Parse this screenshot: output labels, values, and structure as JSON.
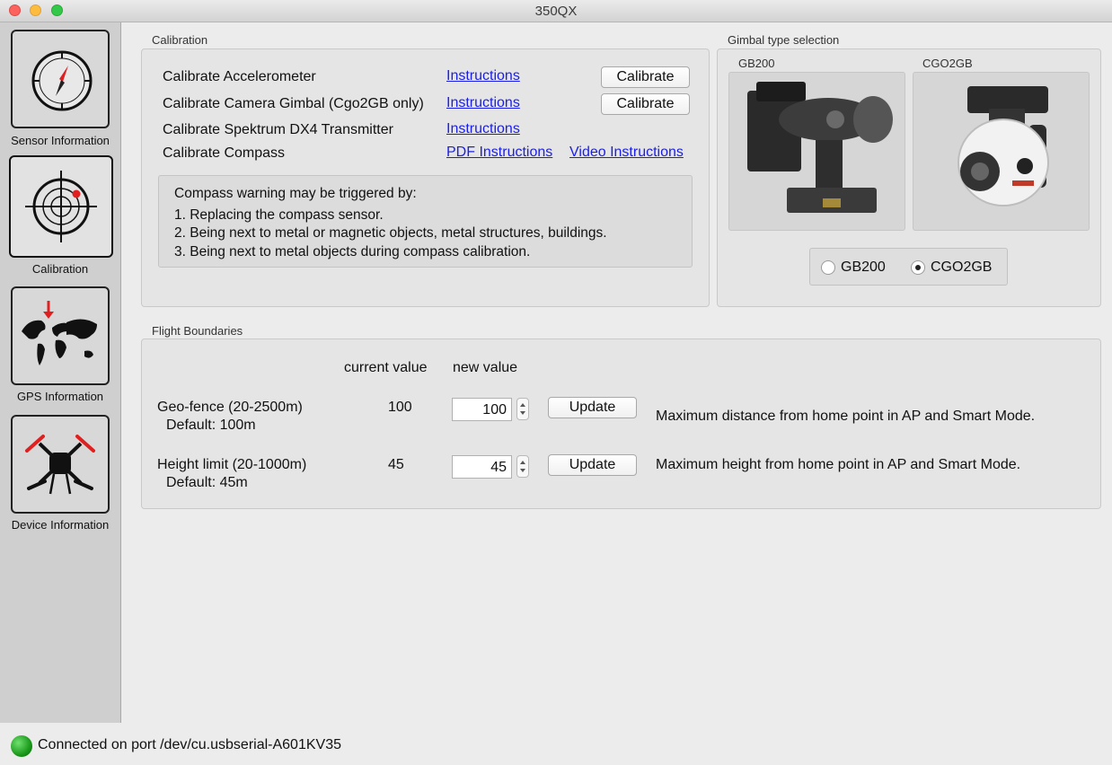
{
  "window": {
    "title": "350QX"
  },
  "sidebar": {
    "items": [
      {
        "label": "Sensor Information",
        "icon": "compass-icon"
      },
      {
        "label": "Calibration",
        "icon": "target-icon",
        "selected": true
      },
      {
        "label": "GPS Information",
        "icon": "world-map-icon"
      },
      {
        "label": "Device Information",
        "icon": "drone-icon"
      }
    ]
  },
  "calibration": {
    "group_title": "Calibration",
    "rows": [
      {
        "label": "Calibrate Accelerometer",
        "link": "Instructions",
        "button": "Calibrate"
      },
      {
        "label": "Calibrate Camera Gimbal (Cgo2GB only)",
        "link": "Instructions",
        "button": "Calibrate"
      },
      {
        "label": "Calibrate Spektrum DX4 Transmitter",
        "link": "Instructions"
      },
      {
        "label": "Calibrate Compass",
        "link": "PDF Instructions",
        "link2": "Video Instructions"
      }
    ],
    "warning": {
      "heading": "Compass warning may be triggered by:",
      "items": [
        "1. Replacing the compass sensor.",
        "2. Being next to metal or magnetic objects, metal structures, buildings.",
        "3. Being next to metal objects during compass calibration."
      ]
    }
  },
  "gimbal": {
    "group_title": "Gimbal type selection",
    "options": [
      {
        "label": "GB200",
        "radio_label": "GB200",
        "checked": false
      },
      {
        "label": "CGO2GB",
        "radio_label": "CGO2GB",
        "checked": true
      }
    ]
  },
  "flight_boundaries": {
    "group_title": "Flight Boundaries",
    "col_current": "current value",
    "col_new": "new value",
    "rows": [
      {
        "label": "Geo-fence (20-2500m)",
        "default": "Default: 100m",
        "current": "100",
        "new_value": "100",
        "button": "Update",
        "description": "Maximum distance from home point in AP and Smart Mode."
      },
      {
        "label": "Height limit (20-1000m)",
        "default": "Default: 45m",
        "current": "45",
        "new_value": "45",
        "button": "Update",
        "description": "Maximum height from home point in AP and Smart Mode."
      }
    ]
  },
  "status": {
    "text": "Connected on port /dev/cu.usbserial-A601KV35",
    "color": "#1a9a1a"
  }
}
